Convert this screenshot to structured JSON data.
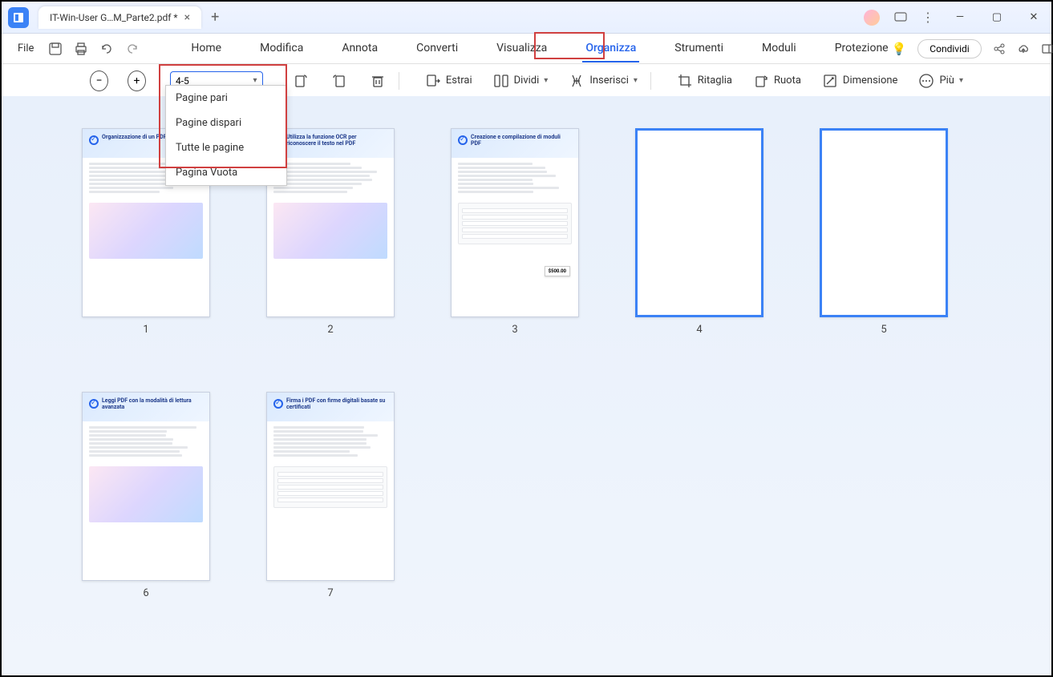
{
  "titlebar": {
    "tab_title": "IT-Win-User G…M_Parte2.pdf *"
  },
  "menubar": {
    "file": "File",
    "items": [
      "Home",
      "Modifica",
      "Annota",
      "Converti",
      "Visualizza",
      "Organizza",
      "Strumenti",
      "Moduli",
      "Protezione"
    ],
    "active_index": 5,
    "share": "Condividi"
  },
  "toolbar": {
    "page_range": "4-5",
    "dropdown_options": [
      "Pagine pari",
      "Pagine dispari",
      "Tutte le pagine",
      "Pagina Vuota"
    ],
    "extract": "Estrai",
    "split": "Dividi",
    "insert": "Inserisci",
    "crop": "Ritaglia",
    "rotate": "Ruota",
    "size": "Dimensione",
    "more": "Più"
  },
  "pages": [
    {
      "num": "1",
      "title": "Organizzazione di un PDF",
      "selected": false,
      "blank": false,
      "style": "gallery"
    },
    {
      "num": "2",
      "title": "Utilizza la funzione OCR per riconoscere il testo nel PDF",
      "selected": false,
      "blank": false,
      "style": "image"
    },
    {
      "num": "3",
      "title": "Creazione e compilazione di moduli PDF",
      "selected": false,
      "blank": false,
      "style": "form",
      "price": "$500.00"
    },
    {
      "num": "4",
      "title": "",
      "selected": true,
      "blank": true
    },
    {
      "num": "5",
      "title": "",
      "selected": true,
      "blank": true
    },
    {
      "num": "6",
      "title": "Leggi PDF con la modalità di lettura avanzata",
      "selected": false,
      "blank": false,
      "style": "image"
    },
    {
      "num": "7",
      "title": "Firma i PDF con firme digitali basate su certificati",
      "selected": false,
      "blank": false,
      "style": "form"
    }
  ]
}
